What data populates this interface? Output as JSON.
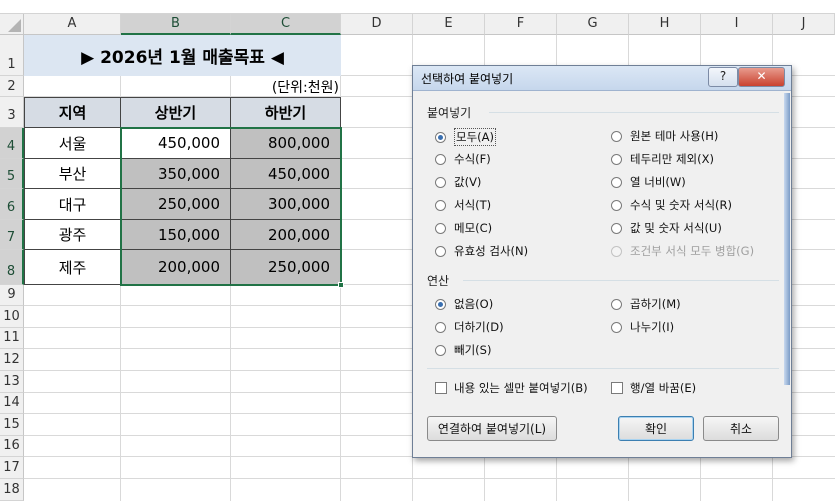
{
  "sheet": {
    "columns": [
      "A",
      "B",
      "C",
      "D",
      "E",
      "F",
      "G",
      "H",
      "I",
      "J"
    ],
    "rows": [
      "1",
      "2",
      "3",
      "4",
      "5",
      "6",
      "7",
      "8",
      "9",
      "10",
      "11",
      "12",
      "13",
      "14",
      "15",
      "16",
      "17",
      "18"
    ],
    "title": "▶ 2026년 1월 매출목표 ◀",
    "unit": "(단위:천원)",
    "table": {
      "headers": [
        "지역",
        "상반기",
        "하반기"
      ],
      "rows": [
        [
          "서울",
          "450,000",
          "800,000"
        ],
        [
          "부산",
          "350,000",
          "450,000"
        ],
        [
          "대구",
          "250,000",
          "300,000"
        ],
        [
          "광주",
          "150,000",
          "200,000"
        ],
        [
          "제주",
          "200,000",
          "250,000"
        ]
      ]
    }
  },
  "dialog": {
    "title": "선택하여 붙여넣기",
    "help_label": "?",
    "close_label": "✕",
    "paste_section": "붙여넣기",
    "paste_left": [
      "모두(A)",
      "수식(F)",
      "값(V)",
      "서식(T)",
      "메모(C)",
      "유효성 검사(N)"
    ],
    "paste_right": [
      "원본 테마 사용(H)",
      "테두리만 제외(X)",
      "열 너비(W)",
      "수식 및 숫자 서식(R)",
      "값 및 숫자 서식(U)",
      "조건부 서식 모두 병합(G)"
    ],
    "op_section": "연산",
    "op_left": [
      "없음(O)",
      "더하기(D)",
      "빼기(S)"
    ],
    "op_right": [
      "곱하기(M)",
      "나누기(I)"
    ],
    "skip_blanks": "내용 있는 셀만 붙여넣기(B)",
    "transpose": "행/열 바꿈(E)",
    "paste_link": "연결하여 붙여넣기(L)",
    "ok": "확인",
    "cancel": "취소"
  },
  "colors": {
    "accent": "#217346",
    "title_fill": "#dce6f2",
    "header_fill": "#d6dce4",
    "copied_fill": "#c0c0c0"
  }
}
